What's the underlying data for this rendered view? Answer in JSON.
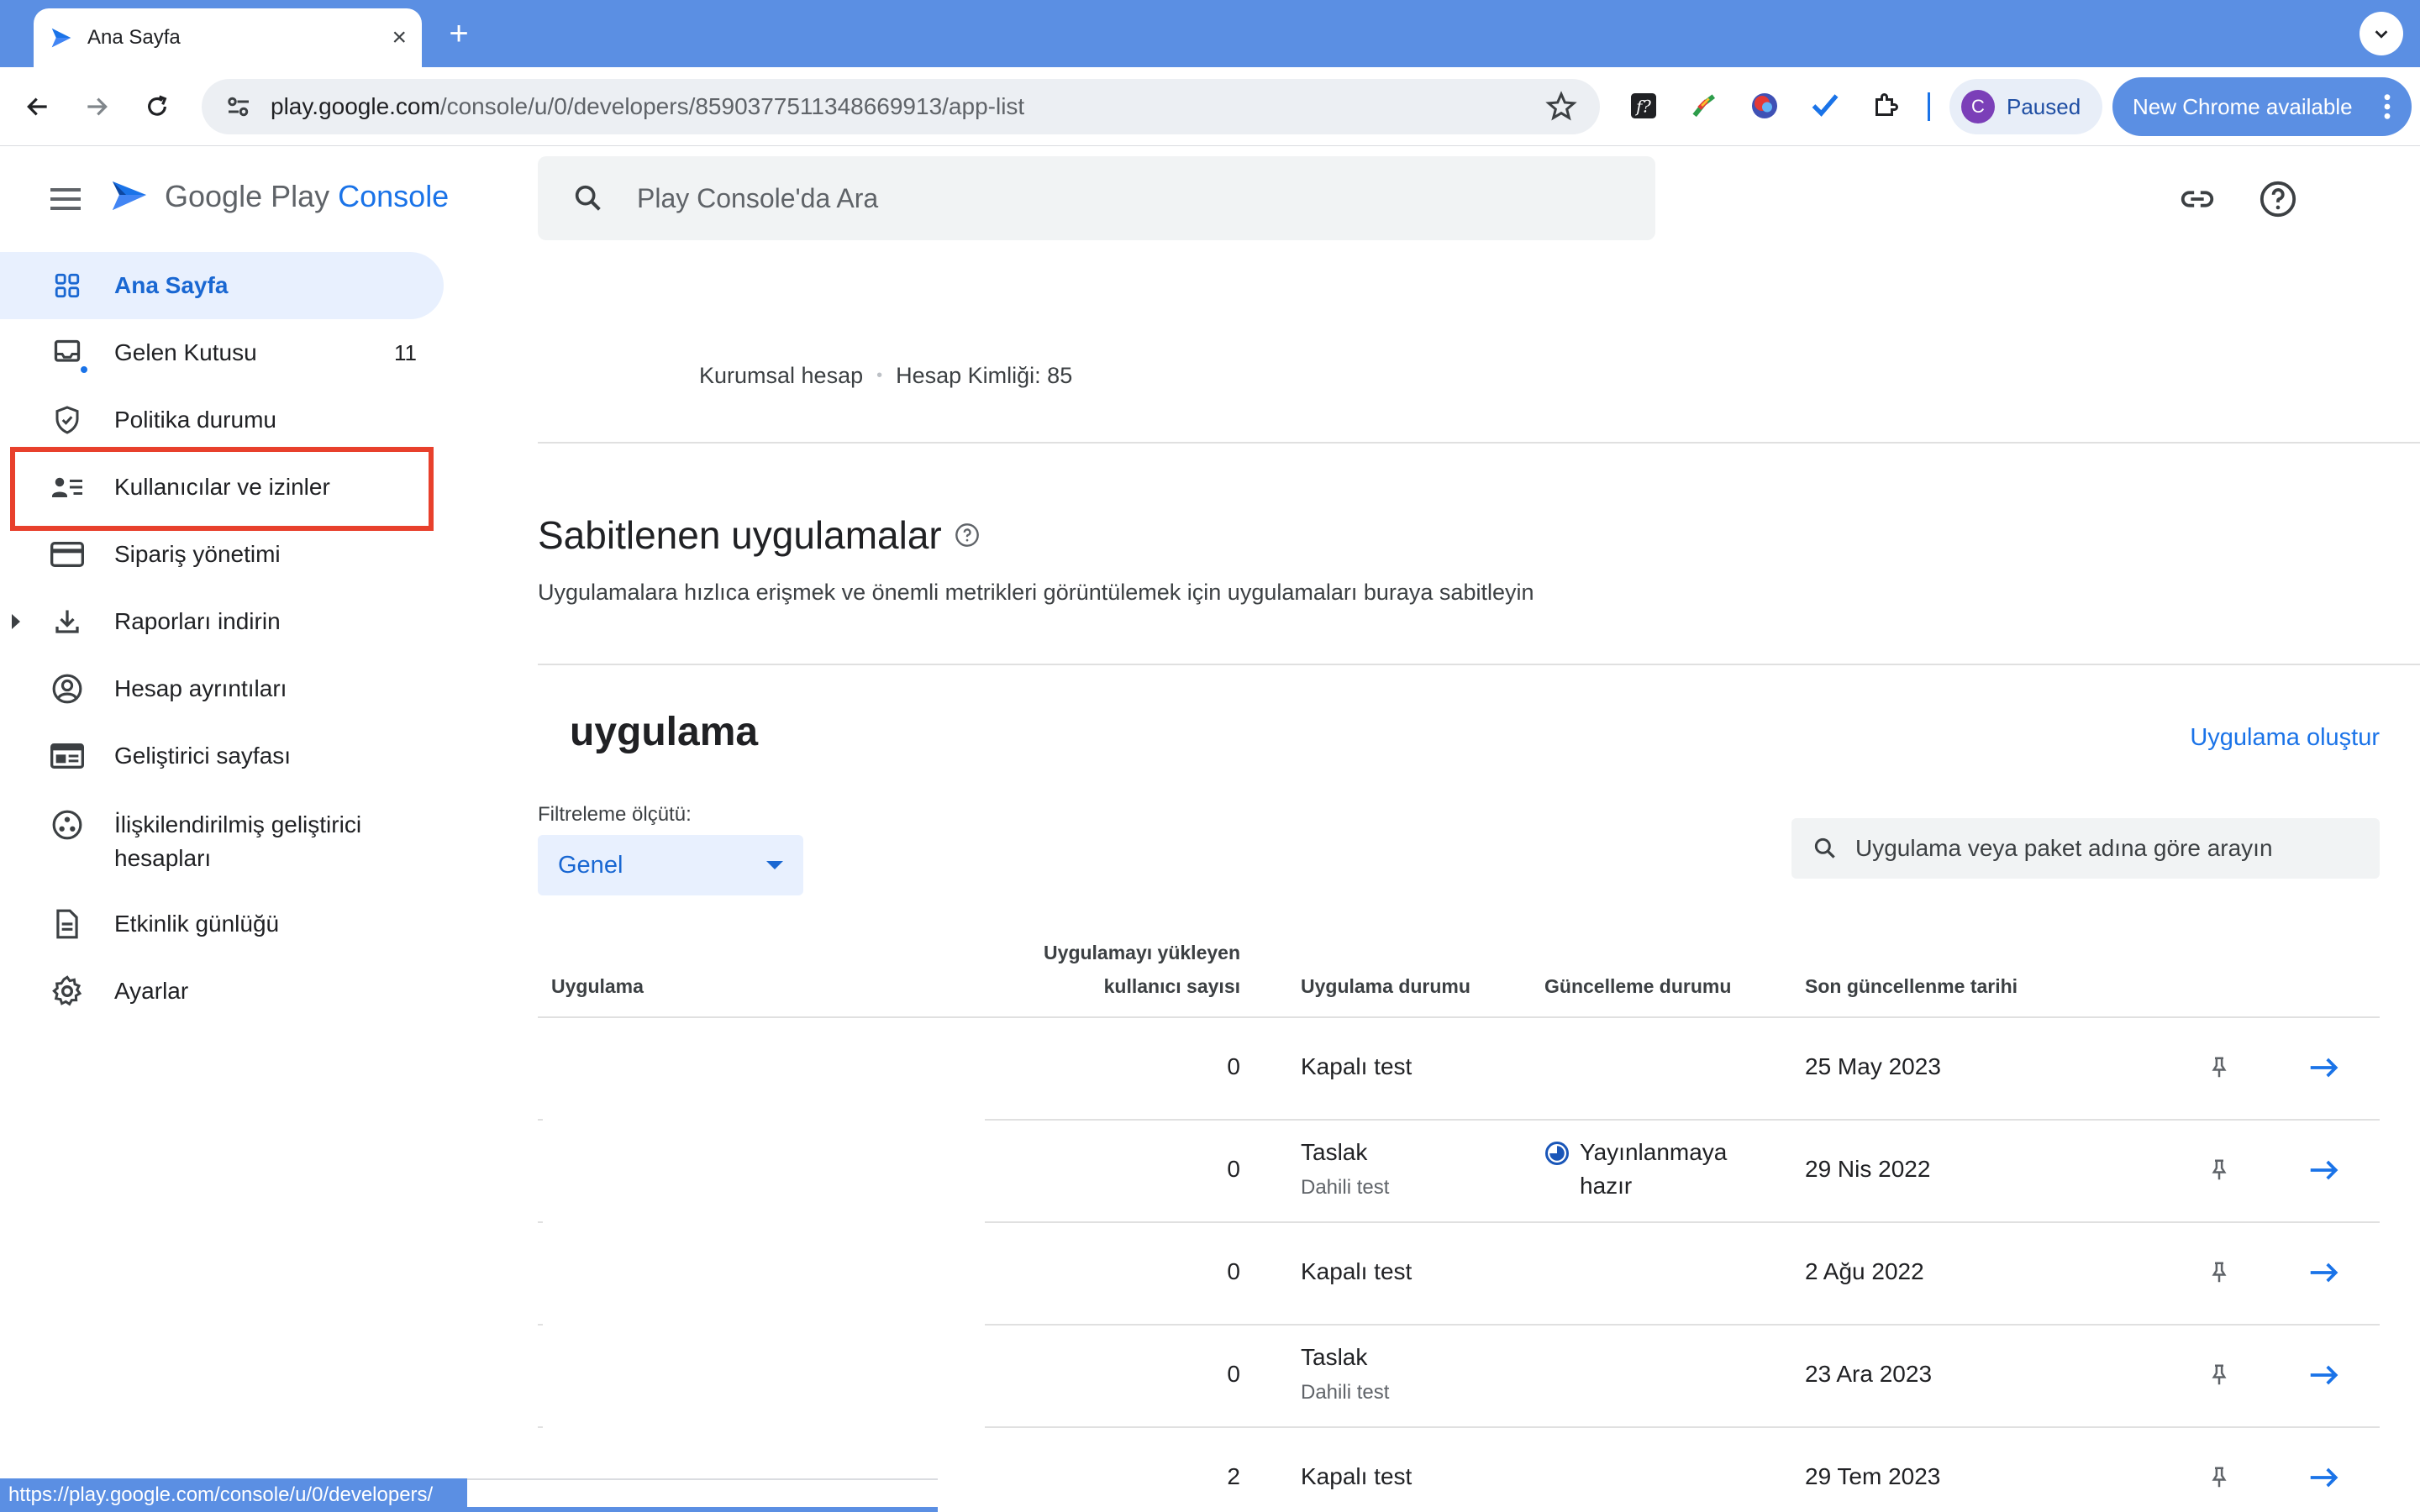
{
  "browser": {
    "tab_title": "Ana Sayfa",
    "url_host": "play.google.com",
    "url_path": "/console/u/0/developers/8590377511348669913/app-list",
    "profile_initial": "C",
    "profile_status": "Paused",
    "update_label": "New Chrome available",
    "status_url": "https://play.google.com/console/u/0/developers/"
  },
  "header": {
    "logo_prefix": "Google Play ",
    "logo_accent": "Console",
    "search_placeholder": "Play Console'da Ara"
  },
  "sidebar": {
    "items": [
      {
        "label": "Ana Sayfa",
        "icon": "dashboard-grid-icon",
        "active": true
      },
      {
        "label": "Gelen Kutusu",
        "icon": "inbox-icon",
        "badge": "11"
      },
      {
        "label": "Politika durumu",
        "icon": "shield-check-icon"
      },
      {
        "label": "Kullanıcılar ve izinler",
        "icon": "people-list-icon"
      },
      {
        "label": "Sipariş yönetimi",
        "icon": "credit-card-icon"
      },
      {
        "label": "Raporları indirin",
        "icon": "download-icon"
      },
      {
        "label": "Hesap ayrıntıları",
        "icon": "account-circle-icon"
      },
      {
        "label": "Geliştirici sayfası",
        "icon": "web-page-icon"
      },
      {
        "label": "İlişkilendirilmiş geliştirici",
        "label2": "hesapları",
        "icon": "linked-accounts-icon"
      },
      {
        "label": "Etkinlik günlüğü",
        "icon": "document-icon"
      },
      {
        "label": "Ayarlar",
        "icon": "gear-icon"
      }
    ]
  },
  "account": {
    "type": "Kurumsal hesap",
    "id_label": "Hesap Kimliği: 85"
  },
  "pinned": {
    "title": "Sabitlenen uygulamalar",
    "description": "Uygulamalara hızlıca erişmek ve önemli metrikleri görüntülemek için uygulamaları buraya sabitleyin"
  },
  "apps": {
    "title": "uygulama",
    "create_label": "Uygulama oluştur",
    "filter_label": "Filtreleme ölçütü:",
    "filter_value": "Genel",
    "search_placeholder": "Uygulama veya paket adına göre arayın",
    "columns": {
      "app": "Uygulama",
      "installs_line1": "Uygulamayı yükleyen",
      "installs_line2": "kullanıcı sayısı",
      "app_status": "Uygulama durumu",
      "update_status": "Güncelleme durumu",
      "last_updated": "Son güncellenme tarihi"
    },
    "rows": [
      {
        "installs": "0",
        "status": "Kapalı test",
        "sub": "",
        "update": "",
        "date": "25 May 2023"
      },
      {
        "installs": "0",
        "status": "Taslak",
        "sub": "Dahili test",
        "update": "Yayınlanmaya hazır",
        "date": "29 Nis 2022"
      },
      {
        "installs": "0",
        "status": "Kapalı test",
        "sub": "",
        "update": "",
        "date": "2 Ağu 2022"
      },
      {
        "installs": "0",
        "status": "Taslak",
        "sub": "Dahili test",
        "update": "",
        "date": "23 Ara 2023"
      },
      {
        "installs": "2",
        "status": "Kapalı test",
        "sub": "",
        "update": "",
        "date": "29 Tem 2023"
      }
    ]
  }
}
